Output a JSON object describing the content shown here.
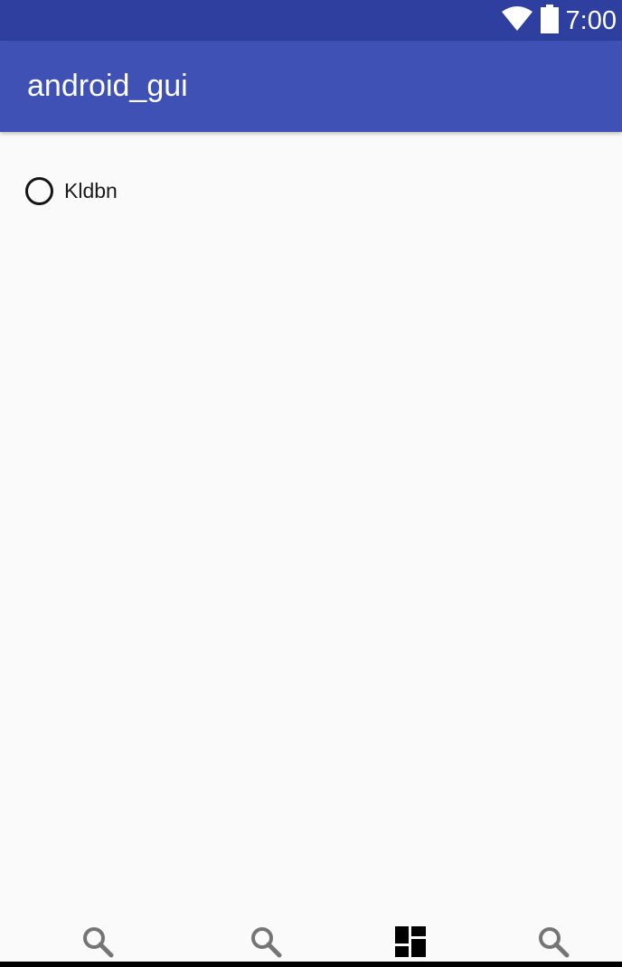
{
  "status_bar": {
    "time": "7:00",
    "icons": [
      "wifi-icon",
      "battery-icon"
    ],
    "color": "#2f3f9f"
  },
  "app_bar": {
    "title": "android_gui",
    "color": "#3f51b5"
  },
  "content": {
    "radio_option": {
      "label": "Kldbn",
      "checked": false
    }
  },
  "bottom_nav": {
    "items": [
      {
        "icon": "search-icon",
        "selected": false
      },
      {
        "icon": "search-icon",
        "selected": false
      },
      {
        "icon": "dashboard-icon",
        "selected": true
      },
      {
        "icon": "search-icon",
        "selected": false
      }
    ]
  }
}
